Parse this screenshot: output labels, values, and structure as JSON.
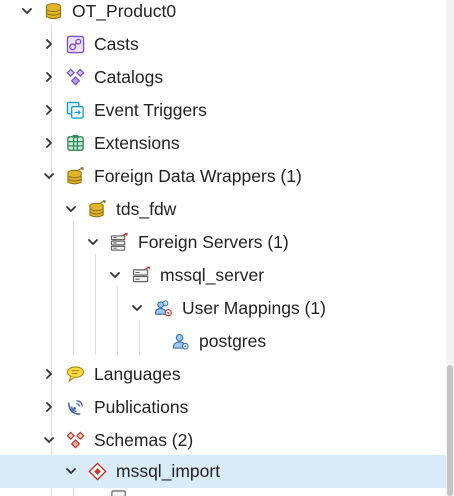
{
  "colors": {
    "selected_row": "#d8ebf6",
    "text": "#222222",
    "database_icon": "#d4a017",
    "icon_purple": "#7b4fc0",
    "icon_teal": "#1a9ec4",
    "icon_green": "#2e8b57",
    "icon_red": "#c0392b",
    "icon_yellow": "#f4d03f"
  },
  "tree": [
    {
      "label": "OT_Product0",
      "icon": "database-icon",
      "expanded": true
    },
    {
      "label": "Casts",
      "icon": "casts-icon",
      "expanded": false
    },
    {
      "label": "Catalogs",
      "icon": "catalogs-icon",
      "expanded": false
    },
    {
      "label": "Event Triggers",
      "icon": "event-triggers-icon",
      "expanded": false
    },
    {
      "label": "Extensions",
      "icon": "extensions-icon",
      "expanded": false
    },
    {
      "label": "Foreign Data Wrappers (1)",
      "icon": "foreign-data-wrappers-icon",
      "expanded": true
    },
    {
      "label": "tds_fdw",
      "icon": "foreign-data-wrapper-icon",
      "expanded": true
    },
    {
      "label": "Foreign Servers (1)",
      "icon": "foreign-servers-icon",
      "expanded": true
    },
    {
      "label": "mssql_server",
      "icon": "foreign-server-icon",
      "expanded": true
    },
    {
      "label": "User Mappings (1)",
      "icon": "user-mappings-icon",
      "expanded": true
    },
    {
      "label": "postgres",
      "icon": "user-mapping-icon"
    },
    {
      "label": "Languages",
      "icon": "languages-icon",
      "expanded": false
    },
    {
      "label": "Publications",
      "icon": "publications-icon",
      "expanded": false
    },
    {
      "label": "Schemas (2)",
      "icon": "schemas-icon",
      "expanded": true
    },
    {
      "label": "mssql_import",
      "icon": "schema-icon",
      "expanded": true,
      "selected": true
    }
  ]
}
